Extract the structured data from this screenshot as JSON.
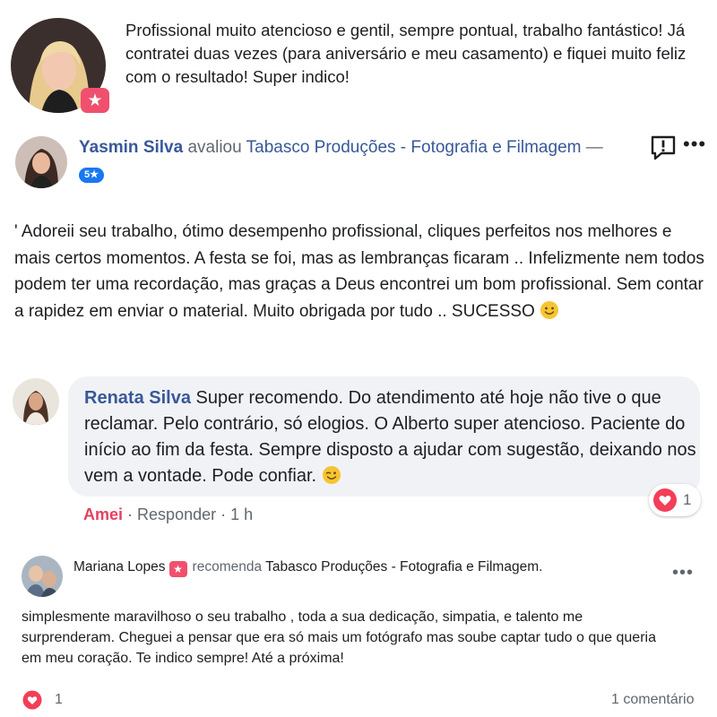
{
  "review1": {
    "text": "Profissional muito atencioso e gentil, sempre pontual, trabalho fantástico! Já contratei duas vezes (para aniversário e meu casamento) e fiquei muito feliz com o resultado! Super indico!"
  },
  "review2": {
    "reviewer": "Yasmin Silva",
    "verb": "avaliou",
    "page": "Tabasco Produções - Fotografia e Filmagem",
    "dash": "—",
    "rating": "5★",
    "text": "' Adoreii seu trabalho, ótimo desempenho profissional, cliques perfeitos nos melhores e mais certos momentos. A festa se foi, mas as lembranças ficaram .. Infelizmente nem todos podem ter uma recordação, mas graças a Deus encontrei um bom profissional. Sem contar a rapidez em enviar o material. Muito obrigada por tudo .. SUCESSO",
    "more": "•••"
  },
  "comment": {
    "author": "Renata Silva",
    "text": "Super recomendo. Do atendimento até hoje não tive o que reclamar. Pelo contrário, só elogios. O Alberto super atencioso. Paciente do início ao fim da festa. Sempre disposto a ajudar com sugestão, deixando nos vem a vontade. Pode confiar.",
    "reaction_count": "1",
    "action_love": "Amei",
    "sep": "·",
    "action_reply": "Responder",
    "time": "1 h"
  },
  "review3": {
    "reviewer": "Mariana Lopes",
    "verb": "recomenda",
    "page": "Tabasco Produções - Fotografia e Filmagem.",
    "more": "•••",
    "text": "simplesmente maravilhoso o seu trabalho , toda a sua dedicação, simpatia, e talento me surprenderam. Cheguei a pensar que era só mais um fotógrafo mas soube captar tudo o que queria em meu coração. Te indico sempre! Até a próxima!",
    "reaction_count": "1",
    "comments": "1 comentário"
  },
  "colors": {
    "link": "#385898",
    "secondary": "#606770",
    "heart": "#f33e58",
    "recommend_badge": "#f0506e",
    "rating_badge": "#1877f2",
    "bubble": "#f0f2f5"
  }
}
